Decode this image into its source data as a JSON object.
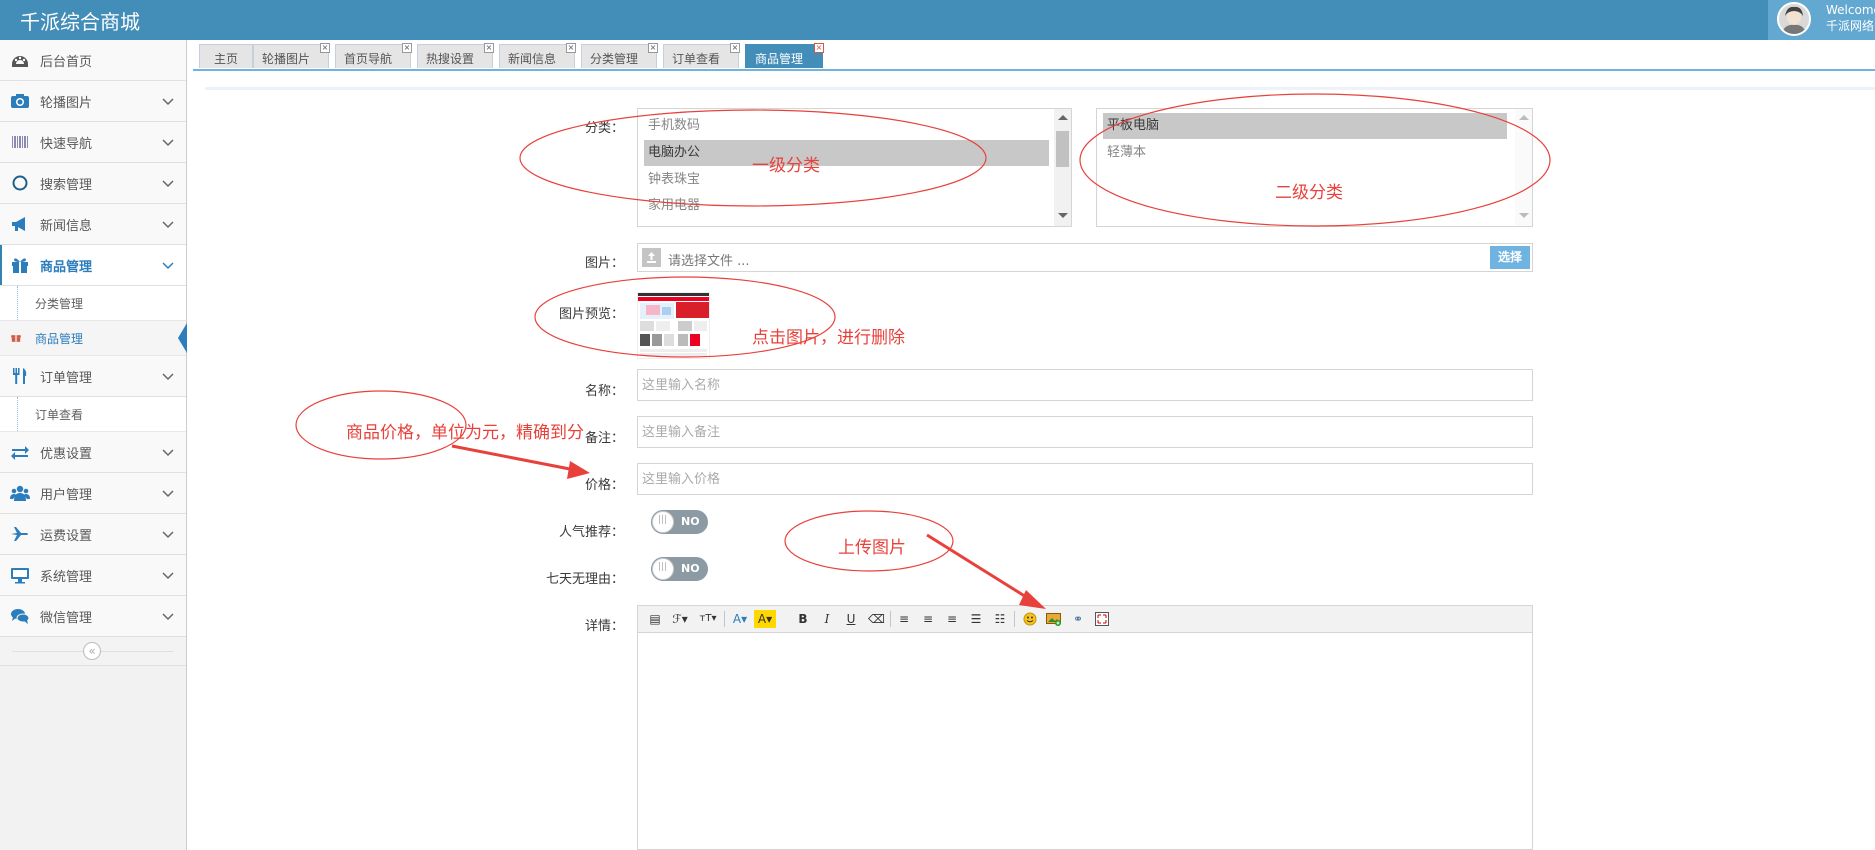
{
  "navbar": {
    "brand": "千派综合商城",
    "welcome": "Welcome",
    "username": "千派网络"
  },
  "sidebar": {
    "items": [
      {
        "label": "后台首页",
        "icon": "dashboard-icon"
      },
      {
        "label": "轮播图片",
        "icon": "camera-icon"
      },
      {
        "label": "快速导航",
        "icon": "barcode-icon"
      },
      {
        "label": "搜索管理",
        "icon": "circle-icon"
      },
      {
        "label": "新闻信息",
        "icon": "bullhorn-icon"
      },
      {
        "label": "商品管理",
        "icon": "gift-icon"
      },
      {
        "label": "分类管理"
      },
      {
        "label": "商品管理",
        "icon": "gift-icon"
      },
      {
        "label": "订单管理",
        "icon": "cutlery-icon"
      },
      {
        "label": "订单查看"
      },
      {
        "label": "优惠设置",
        "icon": "exchange-icon"
      },
      {
        "label": "用户管理",
        "icon": "users-icon"
      },
      {
        "label": "运费设置",
        "icon": "plane-icon"
      },
      {
        "label": "系统管理",
        "icon": "desktop-icon"
      },
      {
        "label": "微信管理",
        "icon": "comments-icon"
      }
    ],
    "collapse_symbol": "«"
  },
  "tabs": [
    {
      "label": "主页"
    },
    {
      "label": "轮播图片"
    },
    {
      "label": "首页导航"
    },
    {
      "label": "热搜设置"
    },
    {
      "label": "新闻信息"
    },
    {
      "label": "分类管理"
    },
    {
      "label": "订单查看"
    },
    {
      "label": "商品管理"
    }
  ],
  "tab_close_symbol": "×",
  "form": {
    "category_label": "分类：",
    "primary_categories": [
      "手机数码",
      "电脑办公",
      "钟表珠宝",
      "家用电器"
    ],
    "primary_selected": "电脑办公",
    "secondary_categories": [
      "平板电脑",
      "轻薄本"
    ],
    "secondary_selected": "平板电脑",
    "image_label": "图片：",
    "file_placeholder": "请选择文件 ...",
    "file_button": "选择",
    "preview_label": "图片预览：",
    "name_label": "名称：",
    "name_placeholder": "这里输入名称",
    "remark_label": "备注：",
    "remark_placeholder": "这里输入备注",
    "price_label": "价格：",
    "price_placeholder": "这里输入价格",
    "popular_label": "人气推荐：",
    "popular_value": "NO",
    "seven_day_label": "七天无理由：",
    "seven_day_value": "NO",
    "detail_label": "详情："
  },
  "editor_toolbar": [
    "source-icon",
    "font-family-icon",
    "font-size-icon",
    "font-color-icon",
    "highlight-icon",
    "bold-icon",
    "italic-icon",
    "underline-icon",
    "clear-format-icon",
    "align-left-icon",
    "align-center-icon",
    "align-right-icon",
    "ordered-list-icon",
    "unordered-list-icon",
    "emoticon-icon",
    "upload-image-icon",
    "link-icon",
    "fullscreen-icon"
  ],
  "annotations": {
    "primary_category": "一级分类",
    "secondary_category": "二级分类",
    "click_to_delete": "点击图片，进行删除",
    "price_note": "商品价格，单位为元，精确到分",
    "upload_image": "上传图片"
  },
  "colors": {
    "navbar": "#438eb9",
    "active_tab": "#438eb9",
    "sidebar_active": "#2b7dbc",
    "annotation": "#e8413b",
    "file_button": "#6fb3e0",
    "toggle_off": "#8b9aa3"
  }
}
